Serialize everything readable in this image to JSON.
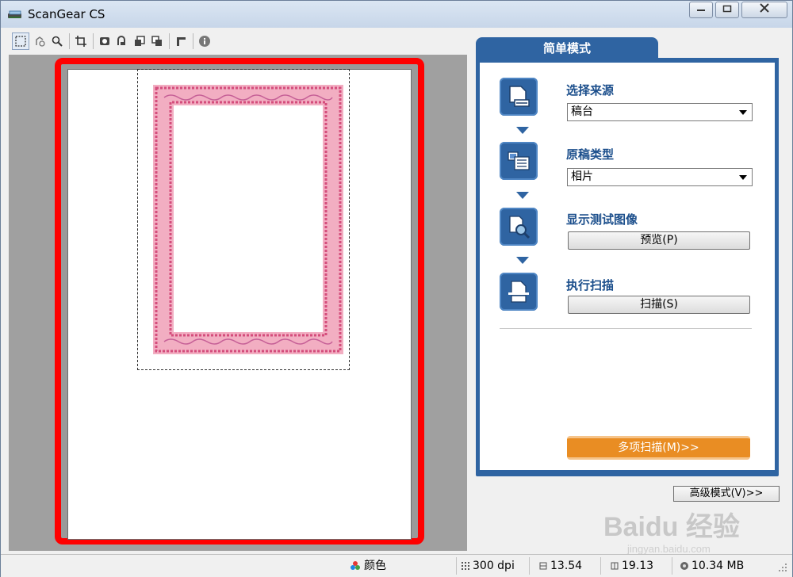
{
  "window": {
    "title": "ScanGear CS"
  },
  "toolbar": {
    "icons": [
      "marquee-select-icon",
      "auto-crop-icon",
      "zoom-icon",
      "crop-frame-icon",
      "mirror-icon",
      "rotate-left-icon",
      "rotate-right-icon",
      "flip-icon",
      "settings-icon",
      "info-icon"
    ]
  },
  "panel": {
    "tab": "简单模式",
    "steps": [
      {
        "label": "选择来源",
        "value": "稿台"
      },
      {
        "label": "原稿类型",
        "value": "相片"
      },
      {
        "label": "显示测试图像",
        "button": "预览(P)"
      },
      {
        "label": "执行扫描",
        "button": "扫描(S)"
      }
    ],
    "multi_scan": "多项扫描(M)>>"
  },
  "advanced_mode": "高级模式(V)>>",
  "status": {
    "color_mode": "颜色",
    "resolution": "300 dpi",
    "width": "13.54",
    "height": "19.13",
    "file_size": "10.34 MB"
  },
  "colors": {
    "accent": "#2f64a2",
    "highlight_frame": "#ff0000",
    "multi_scan": "#e98d23"
  },
  "watermark": {
    "logo": "Baidu 经验",
    "url": "jingyan.baidu.com"
  }
}
